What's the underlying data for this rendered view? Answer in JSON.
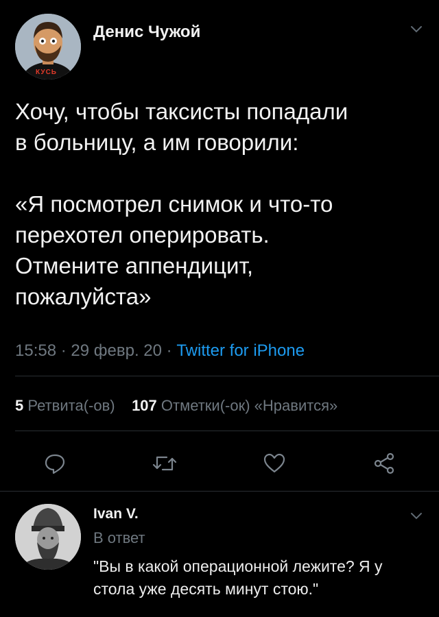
{
  "tweet": {
    "author_name": "Денис Чужой",
    "avatar_badge": "КУСЬ",
    "text": "Хочу, чтобы таксисты попадали\nв больницу, а им говорили:\n\n«Я посмотрел снимок и что-то\nперехотел оперировать.\nОтмените аппендицит,\nпожалуйста»",
    "time": "15:58",
    "date": "29 февр. 20",
    "source": "Twitter for iPhone",
    "separator": " · ",
    "retweets_count": "5",
    "retweets_label": "Ретвита(-ов)",
    "likes_count": "107",
    "likes_label": "Отметки(-ок) «Нравится»"
  },
  "actions": {
    "reply_icon": "reply-icon",
    "retweet_icon": "retweet-icon",
    "like_icon": "heart-icon",
    "share_icon": "share-icon"
  },
  "reply": {
    "author_name": "Ivan V.",
    "reply_label": "В ответ",
    "text": "\"Вы в какой операционной лежите? Я у стола уже десять минут стою.\""
  },
  "colors": {
    "background": "#000000",
    "text": "#f2f2f2",
    "muted": "#6f7880",
    "link": "#1d9bf0",
    "divider": "#2a2f33"
  }
}
